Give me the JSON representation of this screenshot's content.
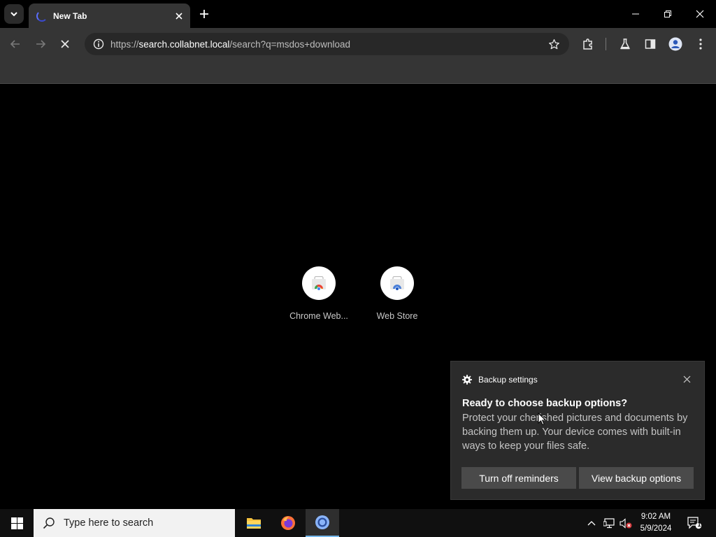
{
  "browser": {
    "tab": {
      "title": "New Tab"
    },
    "address": {
      "scheme": "https://",
      "host": "search.collabnet.local",
      "path": "/search?q=msdos+download"
    }
  },
  "newtab": {
    "shortcuts": [
      {
        "label": "Chrome Web..."
      },
      {
        "label": "Web Store"
      }
    ]
  },
  "toast": {
    "app_name": "Backup settings",
    "title": "Ready to choose backup options?",
    "body": "Protect your cherished pictures and documents by backing them up. Your device comes with built-in ways to keep your files safe.",
    "button_secondary": "Turn off reminders",
    "button_primary": "View backup options"
  },
  "taskbar": {
    "search_placeholder": "Type here to search",
    "time": "9:02 AM",
    "date": "5/9/2024",
    "notification_count": "1"
  },
  "colors": {
    "tab_active": "#353535",
    "toolbar": "#353535",
    "omnibox": "#282828",
    "toast_bg": "#2b2b2b",
    "toast_button": "#4a4a4a",
    "taskbar": "#101010",
    "taskbar_accent": "#76b9ed"
  }
}
